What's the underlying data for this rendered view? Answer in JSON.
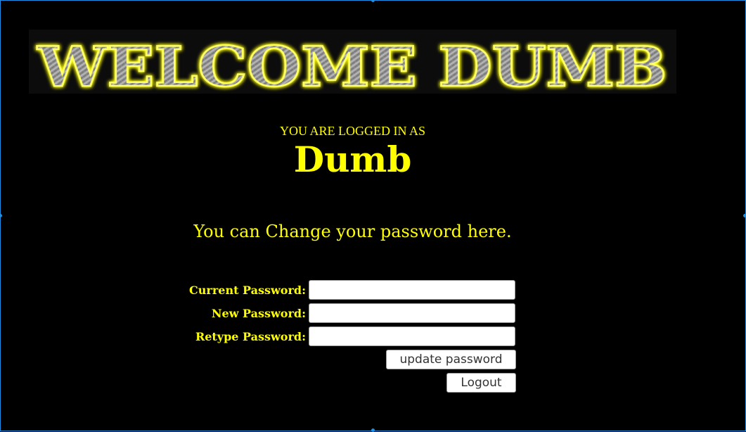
{
  "banner": {
    "text": "WELCOME DUMB"
  },
  "session": {
    "logged_in_label": "YOU ARE LOGGED IN AS",
    "username": "Dumb"
  },
  "message": "You can Change your password here.",
  "form": {
    "current_password_label": "Current Password:",
    "new_password_label": "New Password:",
    "retype_password_label": "Retype Password:",
    "current_password_value": "",
    "new_password_value": "",
    "retype_password_value": "",
    "update_button": "update password",
    "logout_button": "Logout"
  },
  "colors": {
    "background": "#000000",
    "text": "#ffff00",
    "banner_glow": "#ffff00",
    "banner_metal": "#8c8c8c",
    "frame": "#1e90e6"
  }
}
